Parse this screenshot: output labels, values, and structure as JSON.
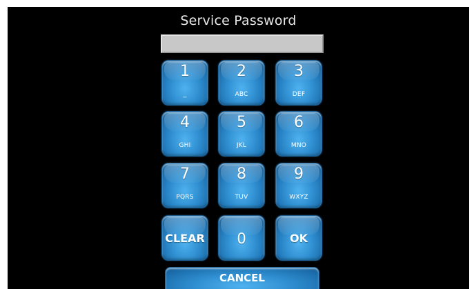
{
  "screen": {
    "title": "Service Password",
    "password_value": ""
  },
  "keypad": {
    "keys": [
      {
        "digit": "1",
        "letters": "_"
      },
      {
        "digit": "2",
        "letters": "ABC"
      },
      {
        "digit": "3",
        "letters": "DEF"
      },
      {
        "digit": "4",
        "letters": "GHI"
      },
      {
        "digit": "5",
        "letters": "JKL"
      },
      {
        "digit": "6",
        "letters": "MNO"
      },
      {
        "digit": "7",
        "letters": "PQRS"
      },
      {
        "digit": "8",
        "letters": "TUV"
      },
      {
        "digit": "9",
        "letters": "WXYZ"
      }
    ],
    "clear_label": "CLEAR",
    "zero_label": "0",
    "ok_label": "OK",
    "cancel_label": "CANCEL"
  },
  "colors": {
    "background": "#000000",
    "key_blue": "#2f8ed0",
    "field_gray": "#c8c8c8"
  }
}
